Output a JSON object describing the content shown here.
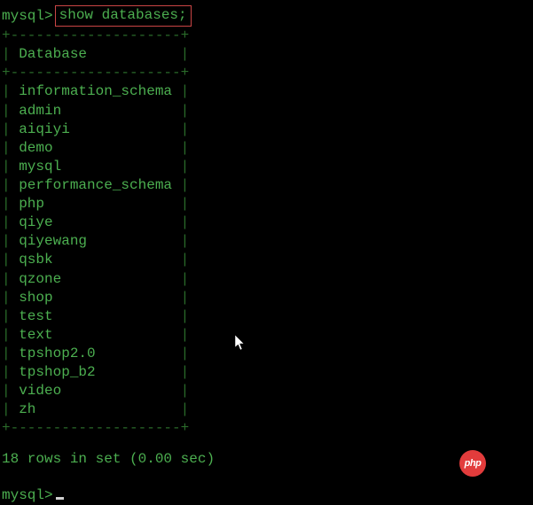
{
  "top_prompt": "mysql>",
  "command": "show databases;",
  "border_top": "+--------------------+",
  "header_label": "Database",
  "border_mid": "+--------------------+",
  "databases": [
    "information_schema",
    "admin",
    "aiqiyi",
    "demo",
    "mysql",
    "performance_schema",
    "php",
    "qiye",
    "qiyewang",
    "qsbk",
    "qzone",
    "shop",
    "test",
    "text",
    "tpshop2.0",
    "tpshop_b2",
    "video",
    "zh"
  ],
  "border_bottom": "+--------------------+",
  "summary_text": "18 rows in set (0.00 sec)",
  "bottom_prompt": "mysql>",
  "badge_text": "php"
}
